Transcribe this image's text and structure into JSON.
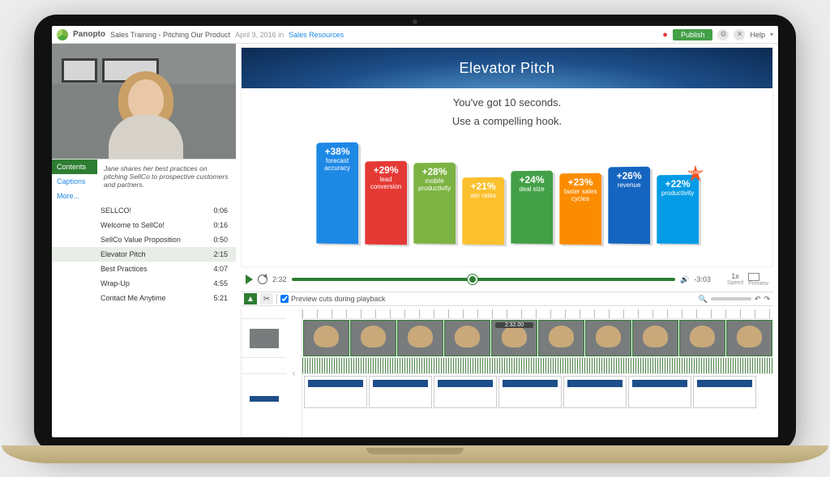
{
  "app": {
    "brand": "Panopto",
    "title": "Sales Training - Pitching Our Product",
    "date": "April 9, 2016 in",
    "breadcrumb_link": "Sales Resources",
    "publish": "Publish",
    "help": "Help"
  },
  "sidebar": {
    "tabs": {
      "contents": "Contents",
      "captions": "Captions",
      "more": "More..."
    },
    "description": "Jane shares her best practices on pitching SellCo to prospective customers and partners.",
    "toc": [
      {
        "label": "SELLCO!",
        "time": "0:06"
      },
      {
        "label": "Welcome to SellCo!",
        "time": "0:16"
      },
      {
        "label": "SellCo Value Proposition",
        "time": "0:50"
      },
      {
        "label": "Elevator Pitch",
        "time": "2:15"
      },
      {
        "label": "Best Practices",
        "time": "4:07"
      },
      {
        "label": "Wrap-Up",
        "time": "4:55"
      },
      {
        "label": "Contact Me Anytime",
        "time": "5:21"
      }
    ],
    "selected_index": 3
  },
  "slide": {
    "title": "Elevator Pitch",
    "line1": "You've got 10 seconds.",
    "line2": "Use a compelling hook."
  },
  "chart_data": {
    "type": "bar",
    "categories": [
      "forecast accuracy",
      "lead conversion",
      "mobile productivity",
      "win rates",
      "deal size",
      "faster sales cycles",
      "revenue",
      "productivity"
    ],
    "values": [
      38,
      29,
      28,
      21,
      24,
      23,
      26,
      22
    ],
    "title": "",
    "xlabel": "",
    "ylabel": "",
    "ylim": [
      0,
      40
    ],
    "colors": [
      "#1e88e5",
      "#e53935",
      "#7cb342",
      "#fbc02d",
      "#43a047",
      "#fb8c00",
      "#1565c0",
      "#039be5"
    ],
    "badge_index": 7,
    "badge_text": "New!"
  },
  "player": {
    "elapsed": "2:32",
    "remaining": "-3:03",
    "speed": "1x",
    "speed_label": "Speed",
    "preview": "Preview",
    "progress_pct": 46
  },
  "editor": {
    "checkbox_label": "Preview cuts during playback",
    "clip_tag": "2:32.00",
    "zoom_icon": "search-icon"
  }
}
